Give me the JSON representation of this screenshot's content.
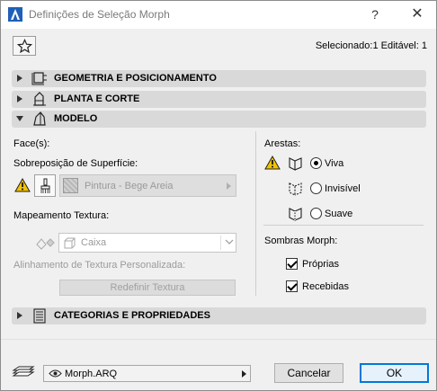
{
  "window": {
    "title": "Definições de Seleção Morph",
    "help_label": "?",
    "close_label": "✕"
  },
  "toolbar": {
    "favorites_icon": "star-icon",
    "selection_info": "Selecionado:1 Editável: 1"
  },
  "sections": [
    {
      "label": "GEOMETRIA E POSICIONAMENTO",
      "expanded": false,
      "icon": "geometry-icon"
    },
    {
      "label": "PLANTA E CORTE",
      "expanded": false,
      "icon": "floor-plan-icon"
    },
    {
      "label": "MODELO",
      "expanded": true,
      "icon": "model-icon"
    },
    {
      "label": "CATEGORIAS E PROPRIEDADES",
      "expanded": false,
      "icon": "categories-icon"
    }
  ],
  "model": {
    "faces_label": "Face(s):",
    "surface_override_label": "Sobreposição de Superfície:",
    "surface_value": "Pintura - Bege Areia",
    "texture_mapping_label": "Mapeamento Textura:",
    "texture_mapping_value": "Caixa",
    "custom_texture_label": "Alinhamento de Textura Personalizada:",
    "reset_texture_label": "Redefinir Textura",
    "edges_label": "Arestas:",
    "edge_options": [
      {
        "label": "Viva",
        "checked": true
      },
      {
        "label": "Invisível",
        "checked": false
      },
      {
        "label": "Suave",
        "checked": false
      }
    ],
    "shadows_label": "Sombras Morph:",
    "shadow_options": [
      {
        "label": "Próprias",
        "checked": true
      },
      {
        "label": "Recebidas",
        "checked": true
      }
    ]
  },
  "footer": {
    "layer_value": "Morph.ARQ",
    "cancel_label": "Cancelar",
    "ok_label": "OK"
  },
  "colors": {
    "section_bg": "#d9d9d9",
    "ok_border": "#0078d7",
    "warning": "#f2c300"
  }
}
